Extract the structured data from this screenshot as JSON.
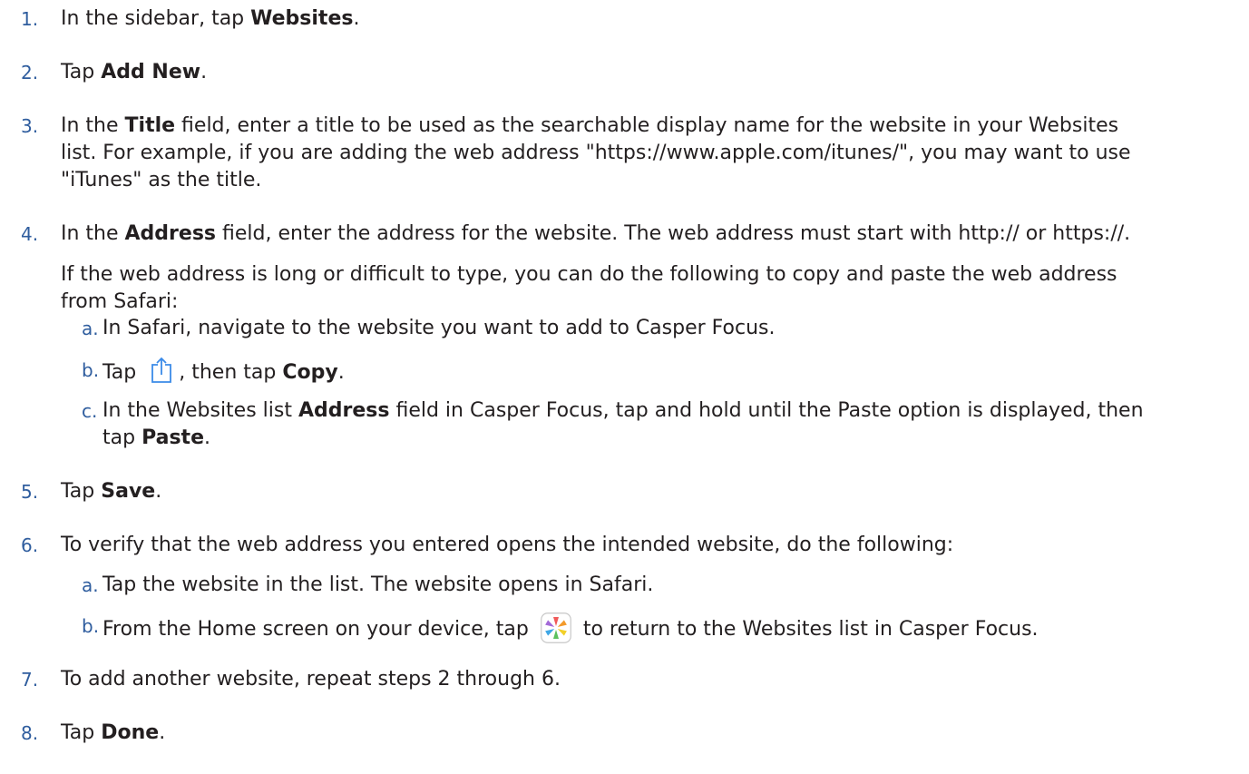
{
  "steps": [
    {
      "num": "1.",
      "pre": "In the sidebar, tap ",
      "bold": "Websites",
      "post": "."
    },
    {
      "num": "2.",
      "pre": "Tap ",
      "bold": "Add New",
      "post": "."
    },
    {
      "num": "3.",
      "l1_pre": "In the ",
      "l1_bold": "Title",
      "l1_post": " field, enter a title to be used as the searchable display name for the website in your Websites",
      "l2": "list. For example, if you are adding the web address \"https://www.apple.com/itunes/\", you may want to use",
      "l3": "\"iTunes\" as the title."
    },
    {
      "num": "4.",
      "l1_pre": "In the ",
      "l1_bold": "Address",
      "l1_post": " field, enter the address for the website. The web address must start with http:// or https://.",
      "p2_l1": "If the web address is long or difficult to type, you can do the following to copy and paste the web address",
      "p2_l2": "from Safari:",
      "sub": [
        {
          "num": "a.",
          "text": "In Safari, navigate to the website you want to add to Casper Focus."
        },
        {
          "num": "b.",
          "pre": "Tap ",
          "icon": "share-icon",
          "mid": ", then tap ",
          "bold": "Copy",
          "post": "."
        },
        {
          "num": "c.",
          "l1_pre": "In the Websites list ",
          "l1_bold": "Address",
          "l1_post": " field in Casper Focus, tap and hold until the Paste option is displayed, then",
          "l2_pre": "tap ",
          "l2_bold": "Paste",
          "l2_post": "."
        }
      ]
    },
    {
      "num": "5.",
      "pre": "Tap ",
      "bold": "Save",
      "post": "."
    },
    {
      "num": "6.",
      "text": "To verify that the web address you entered opens the intended website, do the following:",
      "sub": [
        {
          "num": "a.",
          "text": "Tap the website in the list. The website opens in Safari."
        },
        {
          "num": "b.",
          "pre": "From the Home screen on your device, tap ",
          "icon": "casper-focus-app-icon",
          "post": " to return to the Websites list in Casper Focus."
        }
      ]
    },
    {
      "num": "7.",
      "text": "To add another website, repeat steps 2 through 6."
    },
    {
      "num": "8.",
      "pre": "Tap ",
      "bold": "Done",
      "post": "."
    }
  ],
  "colors": {
    "step_number": "#2f5d9e",
    "text": "#231f20",
    "share_icon": "#3b8be8"
  }
}
